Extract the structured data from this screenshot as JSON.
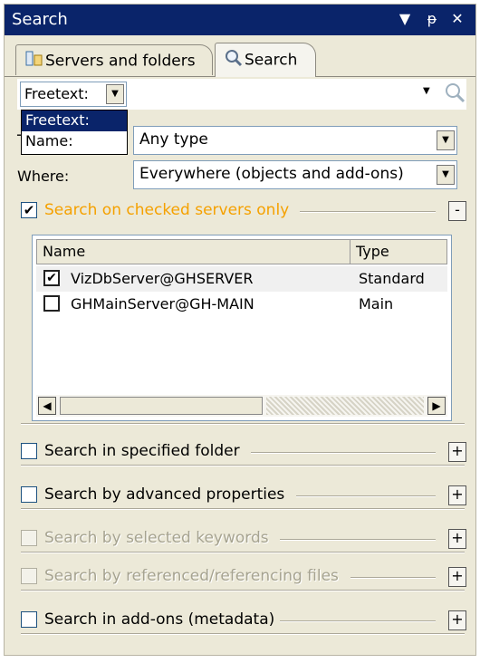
{
  "window": {
    "title": "Search",
    "controls": [
      "▼",
      "ᵽ",
      "✕"
    ]
  },
  "tabs": [
    {
      "label": "Servers and folders",
      "active": false
    },
    {
      "label": "Search",
      "active": true
    }
  ],
  "searchbar": {
    "mode_value": "Freetext:",
    "query_value": "",
    "query_placeholder": ""
  },
  "mode_dropdown": {
    "options": [
      "Freetext:",
      "Name:"
    ],
    "selected": "Freetext:"
  },
  "filters": {
    "type_label": "T",
    "type_value": "Any type",
    "where_label": "Where:",
    "where_value": "Everywhere (objects and add-ons)"
  },
  "sections": [
    {
      "label": "Search on checked servers only",
      "checked": true,
      "enabled": true,
      "toggle": "-"
    },
    {
      "label": "Search in specified folder",
      "checked": false,
      "enabled": true,
      "toggle": "+"
    },
    {
      "label": "Search by advanced properties",
      "checked": false,
      "enabled": true,
      "toggle": "+"
    },
    {
      "label": "Search by selected keywords",
      "checked": false,
      "enabled": false,
      "toggle": "+"
    },
    {
      "label": "Search by referenced/referencing files",
      "checked": false,
      "enabled": false,
      "toggle": "+"
    },
    {
      "label": "Search in add-ons (metadata)",
      "checked": false,
      "enabled": true,
      "toggle": "+"
    }
  ],
  "servers": {
    "columns": [
      "Name",
      "Type"
    ],
    "rows": [
      {
        "name": "VizDbServer@GHSERVER",
        "type": "Standard",
        "checked": true
      },
      {
        "name": "GHMainServer@GH-MAIN",
        "type": "Main",
        "checked": false
      }
    ]
  },
  "colors": {
    "titlebar": "#0a246a",
    "panel": "#ece9d8",
    "accent_label": "#f5a100"
  }
}
